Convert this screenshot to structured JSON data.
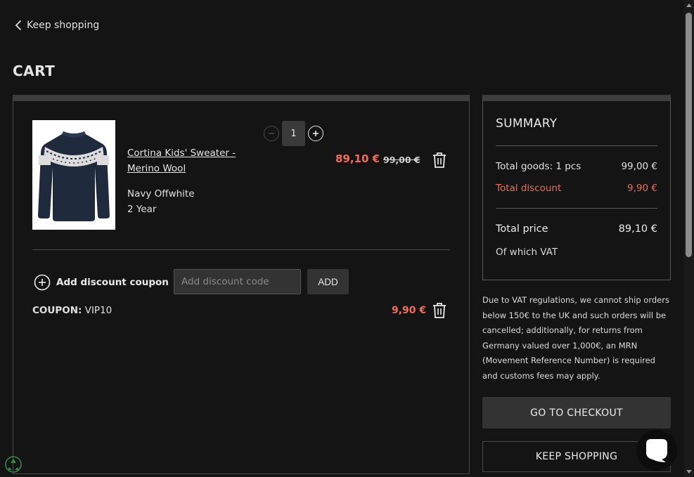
{
  "nav": {
    "keep_shopping_link": "Keep shopping"
  },
  "page": {
    "title": "CART"
  },
  "cart": {
    "item": {
      "name": "Cortina Kids' Sweater - Merino Wool",
      "color": "Navy Offwhite",
      "size": "2 Year",
      "quantity": "1",
      "sale_price": "89,10 €",
      "original_price": "99,00 €"
    },
    "coupon": {
      "add_label": "Add discount coupon",
      "input_placeholder": "Add discount code",
      "add_button": "ADD",
      "applied_prefix": "COUPON:",
      "applied_code": "VIP10",
      "amount": "9,90 €"
    }
  },
  "summary": {
    "title": "SUMMARY",
    "goods_label": "Total goods: 1 pcs",
    "goods_value": "99,00 €",
    "discount_label": "Total discount",
    "discount_value": "9,90 €",
    "total_label": "Total price",
    "total_value": "89,10 €",
    "vat_label": "Of which VAT"
  },
  "notice": "Due to VAT regulations, we cannot ship orders below 150€ to the UK and such orders will be cancelled; additionally, for returns from Germany valued over 1,000€, an MRN (Movement Reference Number) is required and customs fees may apply.",
  "actions": {
    "checkout": "GO TO CHECKOUT",
    "keep_shopping": "KEEP SHOPPING"
  },
  "colors": {
    "background": "#141414",
    "accent_discount": "#f26d5b",
    "button_bg": "#333333"
  },
  "icons": [
    "chevron-left-icon",
    "minus-circle-icon",
    "plus-circle-icon",
    "trash-icon",
    "chat-icon",
    "recycle-icon"
  ]
}
